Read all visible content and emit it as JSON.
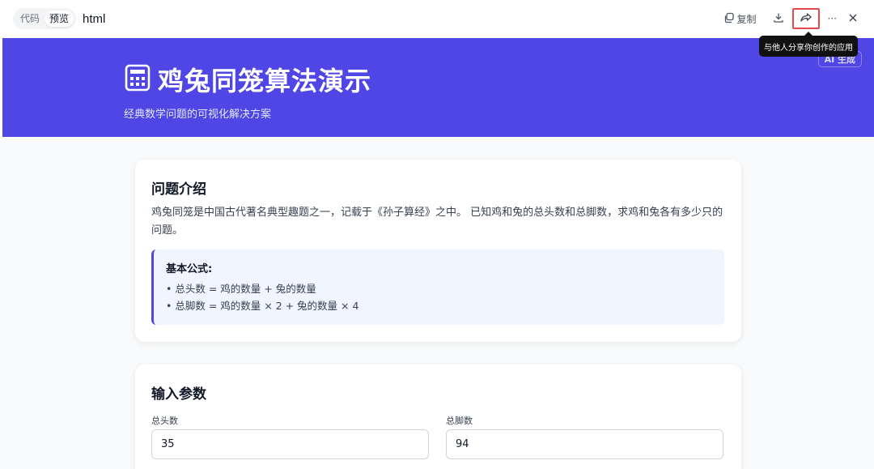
{
  "toolbar": {
    "view_code": "代码",
    "view_preview": "预览",
    "file_title": "html",
    "copy_label": "复制",
    "more_label": "···",
    "share_tooltip": "与他人分享你创作的应用"
  },
  "hero": {
    "title": "鸡兔同笼算法演示",
    "subtitle": "经典数学问题的可视化解决方案",
    "ai_badge": "AI 生成",
    "bg_color": "#4f46e5"
  },
  "intro": {
    "title": "问题介绍",
    "text": "鸡兔同笼是中国古代著名典型趣题之一，记载于《孙子算经》之中。 已知鸡和兔的总头数和总脚数，求鸡和兔各有多少只的问题。",
    "formula_title": "基本公式:",
    "formula_lines": [
      "• 总头数 = 鸡的数量 + 兔的数量",
      "• 总脚数 = 鸡的数量 × 2 + 兔的数量 × 4"
    ]
  },
  "params": {
    "title": "输入参数",
    "heads_label": "总头数",
    "heads_value": "35",
    "feet_label": "总脚数",
    "feet_value": "94"
  },
  "icons": [
    "copy-icon",
    "download-icon",
    "share-icon",
    "more-icon",
    "close-icon",
    "calculator-icon"
  ]
}
